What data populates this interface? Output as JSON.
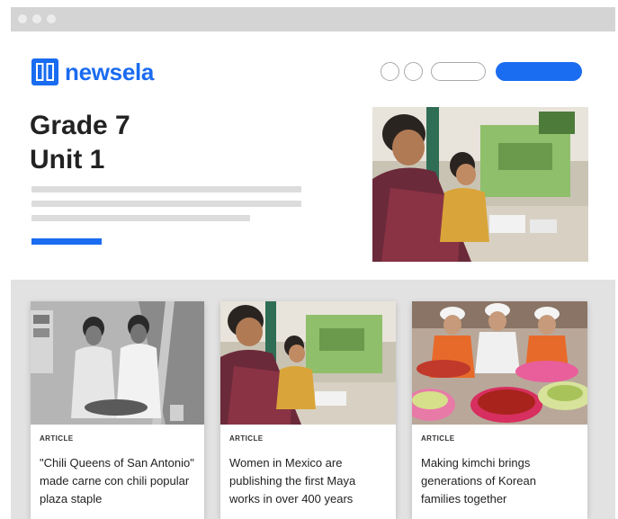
{
  "brand": {
    "name": "newsela",
    "color": "#1a6cf0"
  },
  "header": {
    "title_line1": "Grade 7",
    "title_line2": "Unit 1"
  },
  "hero_image": {
    "icon": "photo-market-workers"
  },
  "cards": [
    {
      "kind": "ARTICLE",
      "title": "\"Chili Queens of San Antonio\" made carne con chili popular plaza staple",
      "icon": "photo-two-women-grinding"
    },
    {
      "kind": "ARTICLE",
      "title": "Women in Mexico are publishing the first Maya works in over 400 years",
      "icon": "photo-women-workshop"
    },
    {
      "kind": "ARTICLE",
      "title": "Making kimchi brings generations of Korean families together",
      "icon": "photo-kimchi-making"
    }
  ],
  "colors": {
    "accent": "#1a6cf0",
    "skeleton": "#dcdcdc",
    "lower_bg": "#e2e2e2"
  }
}
